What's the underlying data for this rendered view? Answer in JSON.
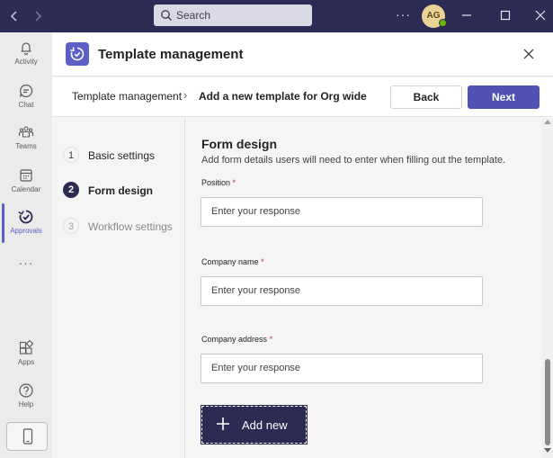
{
  "titlebar": {
    "search_placeholder": "Search",
    "more_label": "···",
    "avatar_initials": "AG"
  },
  "rail": {
    "items": [
      {
        "label": "Activity",
        "icon": "bell-icon"
      },
      {
        "label": "Chat",
        "icon": "chat-icon"
      },
      {
        "label": "Teams",
        "icon": "teams-icon"
      },
      {
        "label": "Calendar",
        "icon": "calendar-icon"
      },
      {
        "label": "Approvals",
        "icon": "approvals-icon",
        "active": true
      },
      {
        "label": "Apps",
        "icon": "apps-icon"
      },
      {
        "label": "Help",
        "icon": "help-icon"
      }
    ],
    "more_label": "···"
  },
  "header": {
    "title": "Template management"
  },
  "breadcrumb": {
    "root": "Template management",
    "separator": "›",
    "current": "Add a new template for Org wide",
    "back_label": "Back",
    "next_label": "Next"
  },
  "steps": [
    {
      "number": "1",
      "label": "Basic settings",
      "state": "done"
    },
    {
      "number": "2",
      "label": "Form design",
      "state": "current"
    },
    {
      "number": "3",
      "label": "Workflow settings",
      "state": "todo"
    }
  ],
  "form": {
    "title": "Form design",
    "description": "Add form details users will need to enter when filling out the template.",
    "fields": [
      {
        "label": "Position",
        "required_mark": "*",
        "placeholder": "Enter your response"
      },
      {
        "label": "Company name",
        "required_mark": "*",
        "placeholder": "Enter your response"
      },
      {
        "label": "Company address",
        "required_mark": "*",
        "placeholder": "Enter your response"
      }
    ],
    "add_label": "Add new"
  },
  "colors": {
    "accent": "#5b5fc7",
    "titlebar": "#2b2b53",
    "primary_button": "#4f52b2",
    "required": "#c4314b"
  }
}
